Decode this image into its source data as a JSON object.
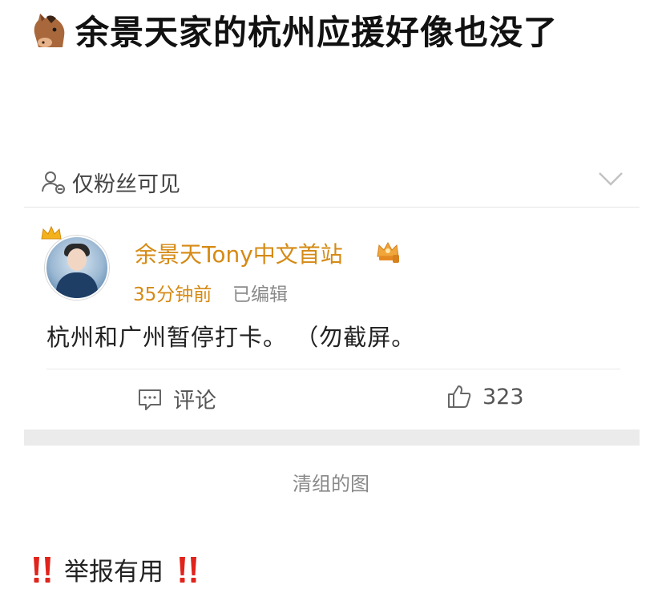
{
  "post": {
    "title": "余景天家的杭州应援好像也没了",
    "title_icon": "horse-face-icon"
  },
  "visibility": {
    "label": "仅粉丝可见",
    "icon": "fans-only-icon"
  },
  "weibo": {
    "author": "余景天Tony中文首站",
    "time": "35分钟前",
    "edited": "已编辑",
    "text": "杭州和广州暂停打卡。 （勿截屏。",
    "comment_label": "评论",
    "like_count": "323"
  },
  "caption": "清组的图",
  "report": {
    "text": "举报有用"
  },
  "colors": {
    "author": "#d58a14",
    "bang": "#e0241b",
    "band": "#ebebeb"
  }
}
